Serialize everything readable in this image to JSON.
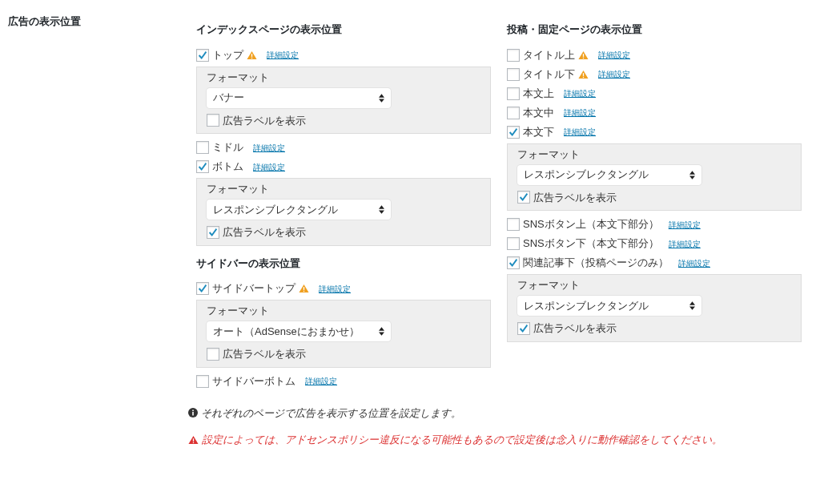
{
  "field_label": "広告の表示位置",
  "columns": [
    [
      {
        "heading": "インデックスページの表示位置",
        "items": [
          {
            "label": "トップ",
            "checked": true,
            "warning": true,
            "link": "詳細設定",
            "settings": {
              "format_label": "フォーマット",
              "format_value": "バナー",
              "ad_label": "広告ラベルを表示",
              "ad_label_checked": false
            }
          },
          {
            "label": "ミドル",
            "checked": false,
            "warning": false,
            "link": "詳細設定"
          },
          {
            "label": "ボトム",
            "checked": true,
            "warning": false,
            "link": "詳細設定",
            "settings": {
              "format_label": "フォーマット",
              "format_value": "レスポンシブレクタングル",
              "ad_label": "広告ラベルを表示",
              "ad_label_checked": true
            }
          }
        ]
      },
      {
        "heading": "サイドバーの表示位置",
        "items": [
          {
            "label": "サイドバートップ",
            "checked": true,
            "warning": true,
            "link": "詳細設定",
            "settings": {
              "format_label": "フォーマット",
              "format_value": "オート（AdSenseにおまかせ）",
              "ad_label": "広告ラベルを表示",
              "ad_label_checked": false
            }
          },
          {
            "label": "サイドバーボトム",
            "checked": false,
            "warning": false,
            "link": "詳細設定"
          }
        ]
      }
    ],
    [
      {
        "heading": "投稿・固定ページの表示位置",
        "items": [
          {
            "label": "タイトル上",
            "checked": false,
            "warning": true,
            "link": "詳細設定"
          },
          {
            "label": "タイトル下",
            "checked": false,
            "warning": true,
            "link": "詳細設定"
          },
          {
            "label": "本文上",
            "checked": false,
            "warning": false,
            "link": "詳細設定"
          },
          {
            "label": "本文中",
            "checked": false,
            "warning": false,
            "link": "詳細設定"
          },
          {
            "label": "本文下",
            "checked": true,
            "warning": false,
            "link": "詳細設定",
            "settings": {
              "format_label": "フォーマット",
              "format_value": "レスポンシブレクタングル",
              "ad_label": "広告ラベルを表示",
              "ad_label_checked": true
            }
          },
          {
            "label": "SNSボタン上（本文下部分）",
            "checked": false,
            "warning": false,
            "link": "詳細設定"
          },
          {
            "label": "SNSボタン下（本文下部分）",
            "checked": false,
            "warning": false,
            "link": "詳細設定"
          },
          {
            "label": "関連記事下（投稿ページのみ）",
            "checked": true,
            "warning": false,
            "link": "詳細設定",
            "settings": {
              "format_label": "フォーマット",
              "format_value": "レスポンシブレクタングル",
              "ad_label": "広告ラベルを表示",
              "ad_label_checked": true
            }
          }
        ]
      }
    ]
  ],
  "notes": [
    {
      "kind": "info",
      "text": "それぞれのページで広告を表示する位置を設定します。"
    },
    {
      "kind": "warning",
      "text": "設定によっては、アドセンスポリシー違反になる可能性もあるので設定後は念入りに動作確認をしてください。"
    }
  ]
}
